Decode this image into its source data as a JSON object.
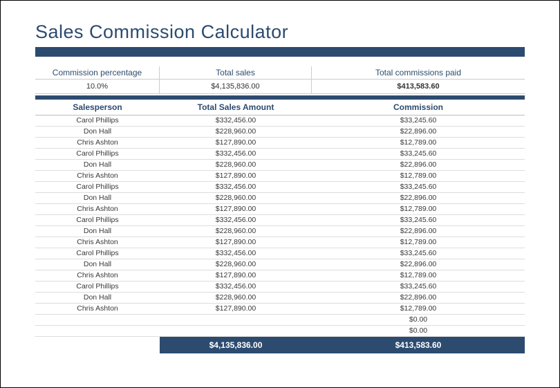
{
  "title": "Sales Commission Calculator",
  "summary": {
    "headers": {
      "commission_pct": "Commission percentage",
      "total_sales": "Total sales",
      "total_commissions": "Total commissions paid"
    },
    "values": {
      "commission_pct": "10.0%",
      "total_sales": "$4,135,836.00",
      "total_commissions": "$413,583.60"
    }
  },
  "table": {
    "headers": {
      "salesperson": "Salesperson",
      "total_sales_amount": "Total Sales Amount",
      "commission": "Commission"
    },
    "rows": [
      {
        "salesperson": "Carol Phillips",
        "amount": "$332,456.00",
        "commission": "$33,245.60"
      },
      {
        "salesperson": "Don Hall",
        "amount": "$228,960.00",
        "commission": "$22,896.00"
      },
      {
        "salesperson": "Chris Ashton",
        "amount": "$127,890.00",
        "commission": "$12,789.00"
      },
      {
        "salesperson": "Carol Phillips",
        "amount": "$332,456.00",
        "commission": "$33,245.60"
      },
      {
        "salesperson": "Don Hall",
        "amount": "$228,960.00",
        "commission": "$22,896.00"
      },
      {
        "salesperson": "Chris Ashton",
        "amount": "$127,890.00",
        "commission": "$12,789.00"
      },
      {
        "salesperson": "Carol Phillips",
        "amount": "$332,456.00",
        "commission": "$33,245.60"
      },
      {
        "salesperson": "Don Hall",
        "amount": "$228,960.00",
        "commission": "$22,896.00"
      },
      {
        "salesperson": "Chris Ashton",
        "amount": "$127,890.00",
        "commission": "$12,789.00"
      },
      {
        "salesperson": "Carol Phillips",
        "amount": "$332,456.00",
        "commission": "$33,245.60"
      },
      {
        "salesperson": "Don Hall",
        "amount": "$228,960.00",
        "commission": "$22,896.00"
      },
      {
        "salesperson": "Chris Ashton",
        "amount": "$127,890.00",
        "commission": "$12,789.00"
      },
      {
        "salesperson": "Carol Phillips",
        "amount": "$332,456.00",
        "commission": "$33,245.60"
      },
      {
        "salesperson": "Don Hall",
        "amount": "$228,960.00",
        "commission": "$22,896.00"
      },
      {
        "salesperson": "Chris Ashton",
        "amount": "$127,890.00",
        "commission": "$12,789.00"
      },
      {
        "salesperson": "Carol Phillips",
        "amount": "$332,456.00",
        "commission": "$33,245.60"
      },
      {
        "salesperson": "Don Hall",
        "amount": "$228,960.00",
        "commission": "$22,896.00"
      },
      {
        "salesperson": "Chris Ashton",
        "amount": "$127,890.00",
        "commission": "$12,789.00"
      },
      {
        "salesperson": "",
        "amount": "",
        "commission": "$0.00"
      },
      {
        "salesperson": "",
        "amount": "",
        "commission": "$0.00"
      }
    ],
    "totals": {
      "amount": "$4,135,836.00",
      "commission": "$413,583.60"
    }
  },
  "colors": {
    "brand": "#2c4b6f"
  }
}
